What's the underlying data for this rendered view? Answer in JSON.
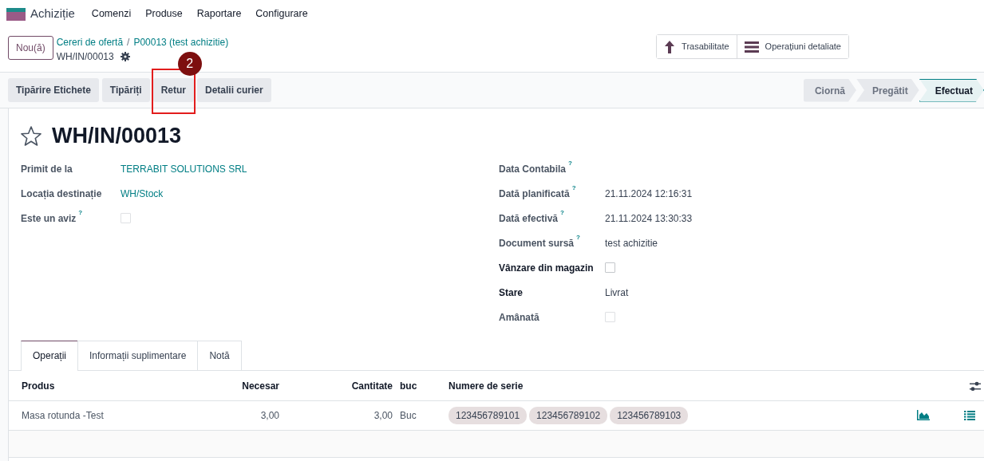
{
  "app": {
    "name": "Achiziție",
    "menu": [
      "Comenzi",
      "Produse",
      "Raportare",
      "Configurare"
    ]
  },
  "control_panel": {
    "new_button": "Nou(ă)",
    "breadcrumbs": [
      "Cereri de ofertă",
      "P00013 (test achizitie)"
    ],
    "breadcrumb_separator": "/",
    "record": "WH/IN/00013",
    "smart_buttons": [
      {
        "kind": "arrow",
        "label": "Trasabilitate"
      },
      {
        "kind": "list",
        "label": "Operațiuni detaliate"
      }
    ]
  },
  "actions": [
    {
      "label": "Tipărire Etichete",
      "highlighted": false
    },
    {
      "label": "Tipăriți",
      "highlighted": false
    },
    {
      "label": "Retur",
      "highlighted": true,
      "callout": "2"
    },
    {
      "label": "Detalii curier",
      "highlighted": false
    }
  ],
  "stages": [
    {
      "label": "Ciornă",
      "selected": false
    },
    {
      "label": "Pregătit",
      "selected": false
    },
    {
      "label": "Efectuat",
      "selected": true
    }
  ],
  "title": {
    "text": "WH/IN/00013",
    "starred": false
  },
  "left_fields": [
    {
      "label": "Primit de la",
      "kind": "link",
      "value": "TERRABIT SOLUTIONS SRL",
      "help": false,
      "strong": false
    },
    {
      "label": "Locația destinație",
      "kind": "link",
      "value": "WH/Stock",
      "help": false,
      "strong": false
    },
    {
      "label": "Este un aviz",
      "kind": "checkbox",
      "checked": false,
      "disabled": true,
      "help": true,
      "strong": false
    }
  ],
  "right_fields": [
    {
      "label": "Data Contabila",
      "kind": "text",
      "help": true,
      "strong": false
    },
    {
      "label": "Dată planificată",
      "kind": "text",
      "value": "21.11.2024 12:16:31",
      "help": true,
      "strong": false
    },
    {
      "label": "Dată efectivă",
      "kind": "text",
      "value": "21.11.2024 13:30:33",
      "help": true,
      "strong": false
    },
    {
      "label": "Document sursă",
      "kind": "text",
      "value": "test achizitie",
      "help": true,
      "strong": false
    },
    {
      "label": "Vânzare din magazin",
      "kind": "checkbox",
      "checked": false,
      "disabled": false,
      "help": false,
      "strong": true
    },
    {
      "label": "Stare",
      "kind": "text",
      "value": "Livrat",
      "help": false,
      "strong": true
    },
    {
      "label": "Amânată",
      "kind": "checkbox",
      "checked": false,
      "disabled": true,
      "help": false,
      "strong": false
    }
  ],
  "help_mark": "?",
  "tabs": [
    {
      "label": "Operații",
      "selected": true
    },
    {
      "label": "Informații suplimentare",
      "selected": false
    },
    {
      "label": "Notă",
      "selected": false
    }
  ],
  "table": {
    "columns": [
      "Produs",
      "Necesar",
      "Cantitate",
      "buc",
      "Numere de serie"
    ],
    "rows": [
      {
        "product": "Masa rotunda -Test",
        "demand": "3,00",
        "quantity": "3,00",
        "uom": "Buc",
        "serials": [
          "123456789101",
          "123456789102",
          "123456789103"
        ]
      }
    ]
  }
}
